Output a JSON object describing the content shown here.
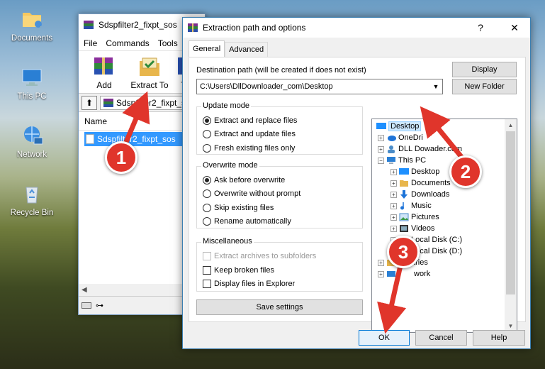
{
  "desktop": {
    "icons": [
      {
        "label": "Documents",
        "icon": "documents-folder-icon"
      },
      {
        "label": "This PC",
        "icon": "this-pc-icon"
      },
      {
        "label": "Network",
        "icon": "network-icon"
      },
      {
        "label": "Recycle Bin",
        "icon": "recycle-bin-icon"
      }
    ]
  },
  "winrar": {
    "title": "Sdspfilter2_fixpt_sos",
    "menu": [
      "File",
      "Commands",
      "Tools"
    ],
    "toolbar": [
      {
        "label": "Add",
        "icon": "add-archive-icon"
      },
      {
        "label": "Extract To",
        "icon": "extract-to-icon"
      },
      {
        "label": "T",
        "icon": "test-icon"
      }
    ],
    "address": "Sdspfilter2_fixpt_sos",
    "column_name": "Name",
    "file": "Sdspfilter2_fixpt_sos"
  },
  "dialog": {
    "title": "Extraction path and options",
    "help_glyph": "?",
    "close_glyph": "✕",
    "tabs": [
      "General",
      "Advanced"
    ],
    "destination_label": "Destination path (will be created if does not exist)",
    "destination_value": "C:\\Users\\DllDownloader_com\\Desktop",
    "display_button": "Display",
    "new_folder_button": "New Folder",
    "update_mode": {
      "title": "Update mode",
      "options": [
        "Extract and replace files",
        "Extract and update files",
        "Fresh existing files only"
      ],
      "selected": 0
    },
    "overwrite_mode": {
      "title": "Overwrite mode",
      "options": [
        "Ask before overwrite",
        "Overwrite without prompt",
        "Skip existing files",
        "Rename automatically"
      ],
      "selected": 0
    },
    "misc": {
      "title": "Miscellaneous",
      "options": [
        "Extract archives to subfolders",
        "Keep broken files",
        "Display files in Explorer"
      ]
    },
    "save_settings": "Save settings",
    "tree": [
      {
        "label": "Desktop",
        "icon": "desktop-icon",
        "selected": true
      },
      {
        "label": "OneDri",
        "icon": "onedrive-icon"
      },
      {
        "label": "DLL Dow",
        "icon": "user-icon",
        "suffix": "ader.com"
      },
      {
        "label": "This PC",
        "icon": "this-pc-icon"
      },
      {
        "label": "Desktop",
        "icon": "desktop-icon"
      },
      {
        "label": "Documents",
        "icon": "documents-icon"
      },
      {
        "label": "Downloads",
        "icon": "downloads-icon"
      },
      {
        "label": "Music",
        "icon": "music-icon"
      },
      {
        "label": "Pictures",
        "icon": "pictures-icon"
      },
      {
        "label": "Videos",
        "icon": "videos-icon"
      },
      {
        "label": "Local Disk (C:)",
        "icon": "local-disk-icon"
      },
      {
        "label": "Local Disk (D:)",
        "icon": "local-disk-icon"
      },
      {
        "label": "aries",
        "icon": "libraries-icon"
      },
      {
        "label": "work",
        "icon": "network-icon"
      }
    ],
    "ok": "OK",
    "cancel": "Cancel",
    "help": "Help"
  },
  "annotations": [
    "1",
    "2",
    "3"
  ],
  "colors": {
    "annotation": "#e0352b",
    "selection": "#3399ff",
    "tree_selection": "#cce8ff"
  }
}
